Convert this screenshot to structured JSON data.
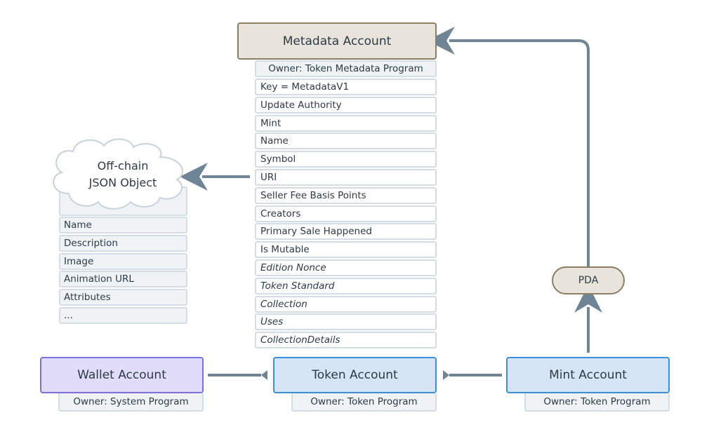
{
  "metadata_account": {
    "title": "Metadata Account",
    "owner": "Owner: Token Metadata Program",
    "fields": [
      {
        "label": "Key = MetadataV1",
        "optional": false
      },
      {
        "label": "Update Authority",
        "optional": false
      },
      {
        "label": "Mint",
        "optional": false
      },
      {
        "label": "Name",
        "optional": false
      },
      {
        "label": "Symbol",
        "optional": false
      },
      {
        "label": "URI",
        "optional": false
      },
      {
        "label": "Seller Fee Basis Points",
        "optional": false
      },
      {
        "label": "Creators",
        "optional": false
      },
      {
        "label": "Primary Sale Happened",
        "optional": false
      },
      {
        "label": "Is Mutable",
        "optional": false
      },
      {
        "label": "Edition Nonce",
        "optional": true
      },
      {
        "label": "Token Standard",
        "optional": true
      },
      {
        "label": "Collection",
        "optional": true
      },
      {
        "label": "Uses",
        "optional": true
      },
      {
        "label": "CollectionDetails",
        "optional": true
      }
    ]
  },
  "offchain_json": {
    "title_line1": "Off-chain",
    "title_line2": "JSON Object",
    "fields": [
      "Name",
      "Description",
      "Image",
      "Animation URL",
      "Attributes",
      "..."
    ]
  },
  "wallet_account": {
    "title": "Wallet Account",
    "owner": "Owner: System Program"
  },
  "token_account": {
    "title": "Token Account",
    "owner": "Owner: Token Program"
  },
  "mint_account": {
    "title": "Mint Account",
    "owner": "Owner: Token Program"
  },
  "pda": {
    "label": "PDA"
  },
  "colors": {
    "arrow": "#6f8494",
    "metadata_fill": "#e8e4dc",
    "metadata_border": "#8c7e62",
    "wallet_fill": "#e0dcfa",
    "wallet_border": "#7b6fe6",
    "token_fill": "#d5e5f6",
    "token_border": "#3b8fe0"
  }
}
